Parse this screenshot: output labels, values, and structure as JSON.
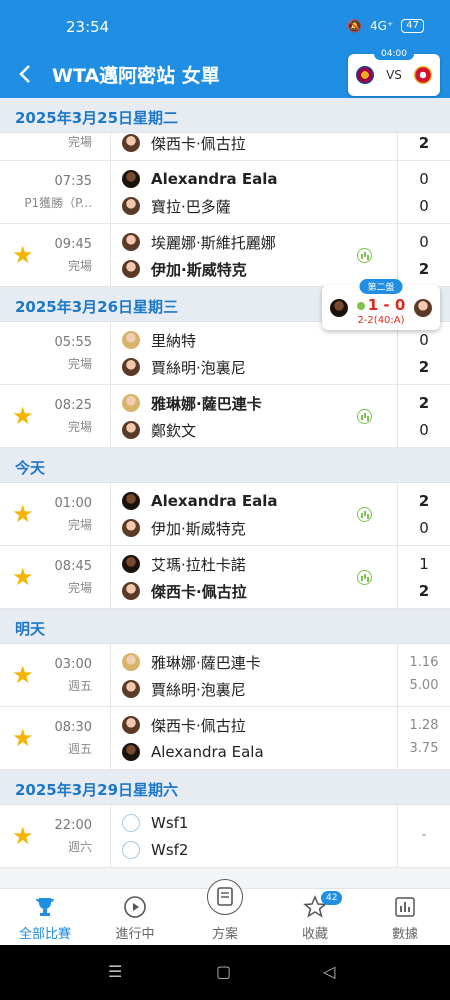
{
  "status": {
    "time": "23:54",
    "battery": "47",
    "signal": "4G⁺"
  },
  "header": {
    "title": "WTA邁阿密站 女單"
  },
  "live_card": {
    "time": "04:00",
    "vs": "VS",
    "home_crest": "barcelona-crest-icon",
    "away_crest": "osasuna-crest-icon"
  },
  "live_popup": {
    "set": "第二盤",
    "score": "1 - 0",
    "points": "2-2(40:A)"
  },
  "sections": [
    {
      "date": "2025年3月25日星期二",
      "partial_first": true,
      "matches": [
        {
          "time": "",
          "status": "完場",
          "starred": false,
          "p1": "",
          "p2": "傑西卡·佩古拉",
          "s1": "",
          "s2": "2",
          "stats": false
        }
      ]
    }
  ],
  "matches": {
    "m1": {
      "time": "07:35",
      "status": "P1獲勝（P...",
      "starred": false,
      "p1": "Alexandra Eala",
      "p2": "寶拉·巴多薩",
      "s1": "0",
      "s2": "0"
    },
    "m2": {
      "time": "09:45",
      "status": "完場",
      "starred": true,
      "p1": "埃麗娜·斯維托麗娜",
      "p2": "伊加·斯威特克",
      "s1": "0",
      "s2": "2"
    },
    "m3": {
      "time": "05:55",
      "status": "完場",
      "starred": false,
      "p1": "里納特",
      "p2": "賈絲明·泡裏尼",
      "s1": "0",
      "s2": "2"
    },
    "m4": {
      "time": "08:25",
      "status": "完場",
      "starred": true,
      "p1": "雅琳娜·薩巴連卡",
      "p2": "鄭欽文",
      "s1": "2",
      "s2": "0"
    },
    "m5": {
      "time": "01:00",
      "status": "完場",
      "starred": true,
      "p1": "Alexandra Eala",
      "p2": "伊加·斯威特克",
      "s1": "2",
      "s2": "0"
    },
    "m6": {
      "time": "08:45",
      "status": "完場",
      "starred": true,
      "p1": "艾瑪·拉杜卡諾",
      "p2": "傑西卡·佩古拉",
      "s1": "1",
      "s2": "2"
    },
    "m7": {
      "time": "03:00",
      "status": "週五",
      "starred": true,
      "p1": "雅琳娜·薩巴連卡",
      "p2": "賈絲明·泡裏尼",
      "o1": "1.16",
      "o2": "5.00"
    },
    "m8": {
      "time": "08:30",
      "status": "週五",
      "starred": true,
      "p1": "傑西卡·佩古拉",
      "p2": "Alexandra Eala",
      "o1": "1.28",
      "o2": "3.75"
    },
    "m9": {
      "time": "22:00",
      "status": "週六",
      "starred": true,
      "p1": "Wsf1",
      "p2": "Wsf2",
      "dash": "-"
    },
    "m0": {
      "p2": "傑西卡·佩古拉",
      "status": "完場",
      "s2": "2"
    }
  },
  "section_titles": {
    "d25": "2025年3月25日星期二",
    "d26": "2025年3月26日星期三",
    "today": "今天",
    "tomorrow": "明天",
    "d29": "2025年3月29日星期六"
  },
  "tabs": [
    {
      "label": "全部比賽",
      "icon": "trophy-icon",
      "active": true
    },
    {
      "label": "進行中",
      "icon": "play-icon"
    },
    {
      "label": "方案",
      "icon": "document-icon"
    },
    {
      "label": "收藏",
      "icon": "star-icon",
      "badge": "42"
    },
    {
      "label": "數據",
      "icon": "bar-chart-icon"
    }
  ],
  "colors": {
    "primary": "#1f8ee3",
    "star": "#f4b400",
    "live": "#e0291a",
    "stats": "#7cc34a"
  }
}
